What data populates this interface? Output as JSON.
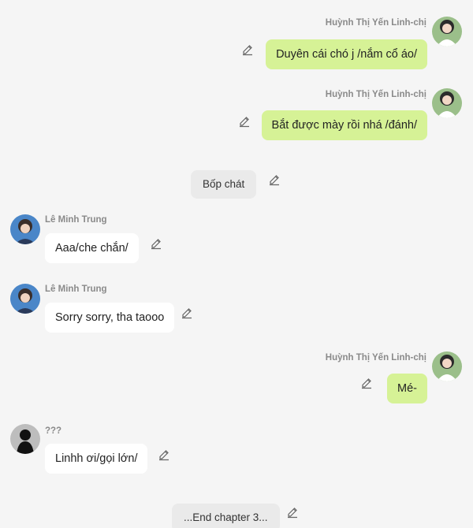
{
  "messages": [
    {
      "sender": "Huỳnh Thị Yến Linh-chị",
      "text": "Duyên cái chó j /nắm cổ áo/",
      "side": "right"
    },
    {
      "sender": "Huỳnh Thị Yến Linh-chị",
      "text": "Bắt được mày rồi nhá /đánh/",
      "side": "right"
    },
    {
      "sender": "",
      "text": "Bốp chát",
      "side": "center"
    },
    {
      "sender": "Lê Minh Trung",
      "text": "Aaa/che chắn/",
      "side": "left"
    },
    {
      "sender": "Lê Minh Trung",
      "text": "Sorry sorry, tha taooo",
      "side": "left"
    },
    {
      "sender": "Huỳnh Thị Yến Linh-chị",
      "text": "Mé-",
      "side": "right"
    },
    {
      "sender": "???",
      "text": "Linhh ơi/gọi lớn/",
      "side": "left"
    },
    {
      "sender": "",
      "text": "...End chapter 3...",
      "side": "center"
    }
  ],
  "colors": {
    "background": "#f5f5f5",
    "bubble_self": "#d6f296",
    "bubble_other": "#ffffff",
    "bubble_narration": "#eaeaea",
    "name_text": "#8a8a8a"
  },
  "icons": {
    "edit": "pencil-edit-icon",
    "avatar_linh": "girl-avatar-icon",
    "avatar_trung": "boy-avatar-icon",
    "avatar_unknown": "silhouette-avatar-icon"
  }
}
